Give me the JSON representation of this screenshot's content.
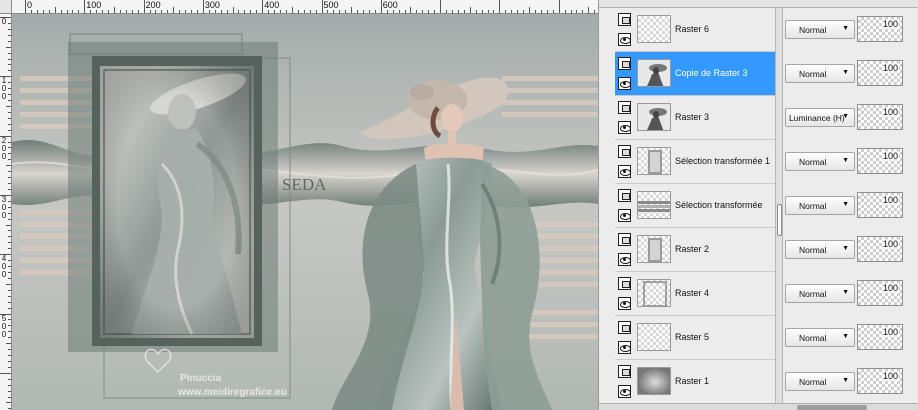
{
  "canvas": {
    "h_ruler_labels": [
      "0",
      "100",
      "200",
      "300",
      "400",
      "500",
      "600"
    ],
    "v_ruler_labels": [
      "0",
      "1 0 0",
      "2 0 0",
      "3 0 0",
      "4 0 0",
      "5 0 0"
    ],
    "artwork_title": "SEDA",
    "watermark_line1": "Pinuccia",
    "watermark_line2": "www.meidiregrafice.eu"
  },
  "layers": [
    {
      "name": "Raster 6",
      "blend": "Normal",
      "opacity": "100",
      "selected": false,
      "thumb": "checker"
    },
    {
      "name": "Copie de Raster 3",
      "blend": "Normal",
      "opacity": "100",
      "selected": true,
      "thumb": "woman"
    },
    {
      "name": "Raster 3",
      "blend": "Luminance (H)",
      "opacity": "100",
      "selected": false,
      "thumb": "woman"
    },
    {
      "name": "Sélection transformée 1",
      "blend": "Normal",
      "opacity": "100",
      "selected": false,
      "thumb": "frame"
    },
    {
      "name": "Sélection transformée",
      "blend": "Normal",
      "opacity": "100",
      "selected": false,
      "thumb": "bands"
    },
    {
      "name": "Raster 2",
      "blend": "Normal",
      "opacity": "100",
      "selected": false,
      "thumb": "frame"
    },
    {
      "name": "Raster 4",
      "blend": "Normal",
      "opacity": "100",
      "selected": false,
      "thumb": "frame-border"
    },
    {
      "name": "Raster 5",
      "blend": "Normal",
      "opacity": "100",
      "selected": false,
      "thumb": "checker"
    },
    {
      "name": "Raster 1",
      "blend": "Normal",
      "opacity": "100",
      "selected": false,
      "thumb": "gradient"
    }
  ],
  "colors": {
    "selection": "#3399ff",
    "artwork_sage": "#8f9c97",
    "artwork_blush": "#c9b7ae"
  }
}
